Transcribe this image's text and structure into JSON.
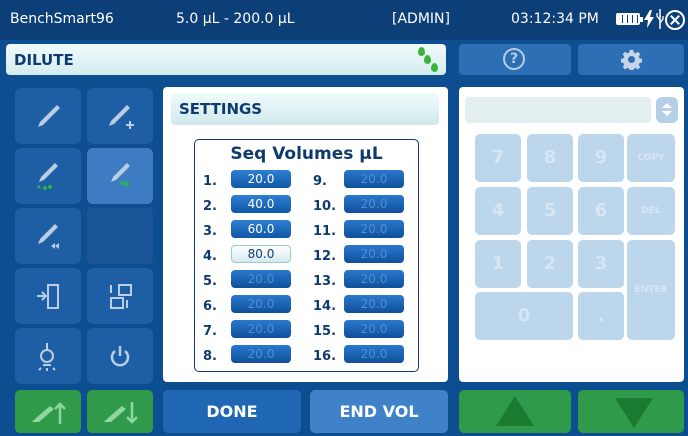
{
  "status_bar": {
    "device_name": "BenchSmart96",
    "volume_range": "5.0 µL - 200.0 µL",
    "user": "[ADMIN]",
    "time": "03:12:34 PM",
    "icons": [
      "battery-icon",
      "charging-bolt-icon",
      "usb-icon",
      "close-icon"
    ]
  },
  "mode_bar": {
    "label": "DILUTE",
    "icon": "droplets-icon"
  },
  "top_buttons": [
    "help-icon",
    "gear-icon"
  ],
  "tools": [
    {
      "name": "aspirate-tool",
      "icon": "pipette-icon"
    },
    {
      "name": "add-tool",
      "icon": "pipette-plus-icon"
    },
    {
      "name": "dispense-tool",
      "icon": "pipette-drops-icon"
    },
    {
      "name": "dilute-tool",
      "icon": "pipette-drops-active-icon",
      "active": true
    },
    {
      "name": "reverse-tool",
      "icon": "pipette-rewind-icon"
    },
    {
      "name": "empty-tool",
      "icon": ""
    },
    {
      "name": "exit-tool",
      "icon": "door-exit-icon"
    },
    {
      "name": "layout-tool",
      "icon": "plate-layout-icon"
    },
    {
      "name": "light-tool",
      "icon": "light-bulb-icon"
    },
    {
      "name": "power-tool",
      "icon": "power-icon"
    }
  ],
  "settings": {
    "title": "SETTINGS",
    "seq_title": "Seq Volumes µL",
    "left_volumes": [
      {
        "num": "1.",
        "value": "20.0",
        "state": "set"
      },
      {
        "num": "2.",
        "value": "40.0",
        "state": "set"
      },
      {
        "num": "3.",
        "value": "60.0",
        "state": "set"
      },
      {
        "num": "4.",
        "value": "80.0",
        "state": "selected"
      },
      {
        "num": "5.",
        "value": "20.0",
        "state": "unset"
      },
      {
        "num": "6.",
        "value": "20.0",
        "state": "unset"
      },
      {
        "num": "7.",
        "value": "20.0",
        "state": "unset"
      },
      {
        "num": "8.",
        "value": "20.0",
        "state": "unset"
      }
    ],
    "right_volumes": [
      {
        "num": "9.",
        "value": "20.0",
        "state": "unset"
      },
      {
        "num": "10.",
        "value": "20.0",
        "state": "unset"
      },
      {
        "num": "11.",
        "value": "20.0",
        "state": "unset"
      },
      {
        "num": "12.",
        "value": "20.0",
        "state": "unset"
      },
      {
        "num": "13.",
        "value": "20.0",
        "state": "unset"
      },
      {
        "num": "14.",
        "value": "20.0",
        "state": "unset"
      },
      {
        "num": "15.",
        "value": "20.0",
        "state": "unset"
      },
      {
        "num": "16.",
        "value": "20.0",
        "state": "unset"
      }
    ]
  },
  "keypad": {
    "entry_value": "",
    "keys": {
      "k7": "7",
      "k8": "8",
      "k9": "9",
      "copy": "COPY",
      "k4": "4",
      "k5": "5",
      "k6": "6",
      "del": "DEL",
      "k1": "1",
      "k2": "2",
      "k3": "3",
      "enter": "ENTER",
      "k0": "0",
      "dot": "."
    }
  },
  "bottom": {
    "done": "DONE",
    "end_vol": "END VOL",
    "icons": [
      "pipette-up-icon",
      "pipette-down-icon",
      "arrow-up-icon",
      "arrow-down-icon"
    ]
  },
  "colors": {
    "background": "#0d4e91",
    "status_bar": "#0c3f78",
    "accent_green": "#2f9a4a",
    "button_blue": "#1f66b3",
    "text_dark": "#0e3b6f"
  }
}
